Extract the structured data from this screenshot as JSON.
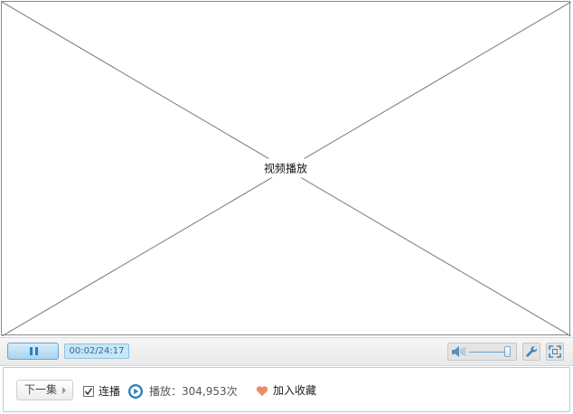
{
  "video": {
    "label": "视频播放"
  },
  "controls": {
    "time": "00:02/24:17",
    "volume_level": 0.92
  },
  "info": {
    "next_label": "下一集",
    "autoplay_label": "连播",
    "autoplay_checked": true,
    "play_count": "播放：304,953次",
    "favorite_label": "加入收藏"
  },
  "colors": {
    "accent": "#2f7fb9",
    "favorite": "#f08a6c"
  },
  "icons": {
    "pause": "pause-icon",
    "speaker": "speaker-icon",
    "settings": "wrench-icon",
    "fullscreen": "fullscreen-icon",
    "play_count": "play-circle-icon",
    "favorite": "heart-icon",
    "next": "chevron-right-icon"
  }
}
